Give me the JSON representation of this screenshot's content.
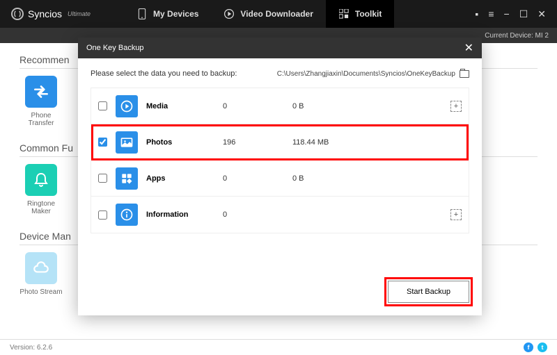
{
  "titlebar": {
    "brand": "Syncios",
    "brand_sub": "Ultimate",
    "tabs": [
      {
        "label": "My Devices"
      },
      {
        "label": "Video Downloader"
      },
      {
        "label": "Toolkit"
      }
    ]
  },
  "subbar": {
    "current_device": "Current Device: MI 2"
  },
  "sections": {
    "recommended": {
      "title": "Recommen",
      "tiles": [
        {
          "label": "Phone Transfer"
        }
      ]
    },
    "common": {
      "title": "Common Fu",
      "tiles": [
        {
          "label": "Ringtone Maker"
        }
      ]
    },
    "device": {
      "title": "Device Man",
      "tiles": [
        {
          "label": "Photo Stream"
        }
      ]
    }
  },
  "modal": {
    "title": "One Key Backup",
    "prompt": "Please select the data you need to backup:",
    "path": "C:\\Users\\Zhangjiaxin\\Documents\\Syncios\\OneKeyBackup",
    "rows": [
      {
        "name": "Media",
        "count": "0",
        "size": "0 B",
        "checked": false,
        "expand": true
      },
      {
        "name": "Photos",
        "count": "196",
        "size": "118.44 MB",
        "checked": true,
        "expand": false,
        "highlight": true
      },
      {
        "name": "Apps",
        "count": "0",
        "size": "0 B",
        "checked": false,
        "expand": false
      },
      {
        "name": "Information",
        "count": "0",
        "size": "",
        "checked": false,
        "expand": true
      }
    ],
    "start_label": "Start Backup"
  },
  "footer": {
    "version": "Version: 6.2.6"
  }
}
